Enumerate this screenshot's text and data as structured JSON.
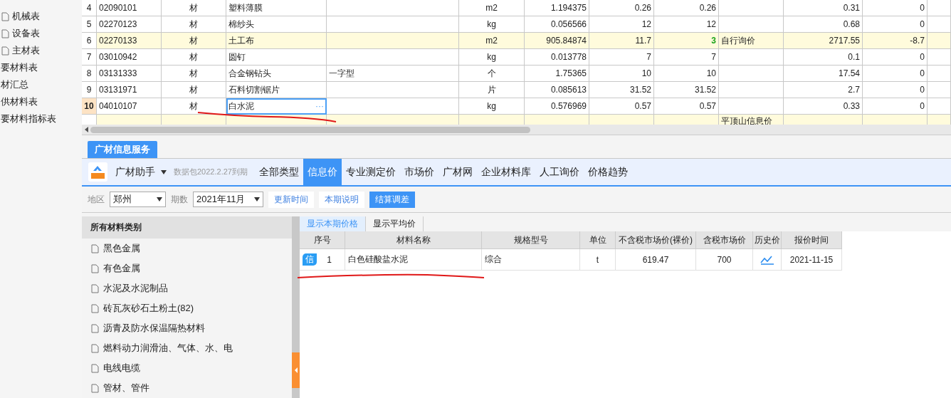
{
  "sidebar": {
    "items": [
      {
        "label": "机械表",
        "kind": "sheet"
      },
      {
        "label": "设备表",
        "kind": "sheet"
      },
      {
        "label": "主材表",
        "kind": "sheet"
      },
      {
        "label": "要材料表",
        "kind": "group"
      },
      {
        "label": "材汇总",
        "kind": "group"
      },
      {
        "label": "供材料表",
        "kind": "group"
      },
      {
        "label": "要材料指标表",
        "kind": "group"
      }
    ]
  },
  "grid": {
    "more_button": "···",
    "rows": [
      {
        "cells": [
          "4",
          "02090101",
          "材",
          "塑料薄膜",
          "",
          "m2",
          "1.194375",
          "0.26",
          "0.26",
          "",
          "0.31",
          "0",
          ""
        ],
        "highlighted": false,
        "selected": false,
        "edited": false
      },
      {
        "cells": [
          "5",
          "02270123",
          "材",
          "棉纱头",
          "",
          "kg",
          "0.056566",
          "12",
          "12",
          "",
          "0.68",
          "0",
          ""
        ],
        "highlighted": false,
        "selected": false,
        "edited": false
      },
      {
        "cells": [
          "6",
          "02270133",
          "材",
          "土工布",
          "",
          "m2",
          "905.84874",
          "11.7",
          "3",
          "自行询价",
          "2717.55",
          "-8.7",
          ""
        ],
        "highlighted": true,
        "selected": false,
        "edited": true
      },
      {
        "cells": [
          "7",
          "03010942",
          "材",
          "圆钉",
          "",
          "kg",
          "0.013778",
          "7",
          "7",
          "",
          "0.1",
          "0",
          ""
        ],
        "highlighted": false,
        "selected": false,
        "edited": false
      },
      {
        "cells": [
          "8",
          "03131333",
          "材",
          "合金钢钻头",
          "一字型",
          "个",
          "1.75365",
          "10",
          "10",
          "",
          "17.54",
          "0",
          ""
        ],
        "highlighted": false,
        "selected": false,
        "edited": false
      },
      {
        "cells": [
          "9",
          "03131971",
          "材",
          "石料切割锯片",
          "",
          "片",
          "0.085613",
          "31.52",
          "31.52",
          "",
          "2.7",
          "0",
          ""
        ],
        "highlighted": false,
        "selected": false,
        "edited": false
      },
      {
        "cells": [
          "10",
          "04010107",
          "材",
          "白水泥",
          "",
          "kg",
          "0.576969",
          "0.57",
          "0.57",
          "",
          "0.33",
          "0",
          ""
        ],
        "highlighted": false,
        "selected": true,
        "edited": false
      },
      {
        "cells": [
          "",
          "",
          "",
          "",
          "",
          "",
          "",
          "",
          "",
          "平顶山信息价",
          "",
          "",
          ""
        ],
        "highlighted": true,
        "selected": false,
        "edited": false
      }
    ]
  },
  "service": {
    "tab": "广材信息服务",
    "app_name": "广材助手",
    "package_note": "数据包2022.2.27到期",
    "tabs": [
      {
        "label": "全部类型",
        "selected": false
      },
      {
        "label": "信息价",
        "selected": true
      },
      {
        "label": "专业测定价",
        "selected": false
      },
      {
        "label": "市场价",
        "selected": false
      },
      {
        "label": "广材网",
        "selected": false
      },
      {
        "label": "企业材料库",
        "selected": false
      },
      {
        "label": "人工询价",
        "selected": false
      },
      {
        "label": "价格趋势",
        "selected": false
      }
    ],
    "filters": [
      {
        "label": "地区",
        "value": "郑州"
      },
      {
        "label": "期数",
        "value": "2021年11月"
      }
    ],
    "buttons": [
      {
        "label": "更新时间",
        "kind": "link"
      },
      {
        "label": "本期说明",
        "kind": "link"
      },
      {
        "label": "结算调差",
        "kind": "primary"
      }
    ],
    "categories": {
      "title": "所有材料类别",
      "items": [
        "黑色金属",
        "有色金属",
        "水泥及水泥制品",
        "砖瓦灰砂石土粉土(82)",
        "沥青及防水保温隔热材料",
        "燃料动力润滑油、气体、水、电",
        "电线电缆",
        "管材、管件"
      ]
    },
    "view_tabs": [
      {
        "label": "显示本期价格",
        "selected": true
      },
      {
        "label": "显示平均价",
        "selected": false
      }
    ],
    "table": {
      "columns": [
        "序号",
        "材料名称",
        "规格型号",
        "单位",
        "不含税市场价(裸价)",
        "含税市场价",
        "历史价",
        "报价时间"
      ],
      "rows": [
        {
          "badge": "信",
          "no": "1",
          "name": "白色硅酸盐水泥",
          "spec": "综合",
          "unit": "t",
          "price_ex_tax": "619.47",
          "price_tax": "700",
          "date": "2021-11-15"
        }
      ]
    }
  }
}
